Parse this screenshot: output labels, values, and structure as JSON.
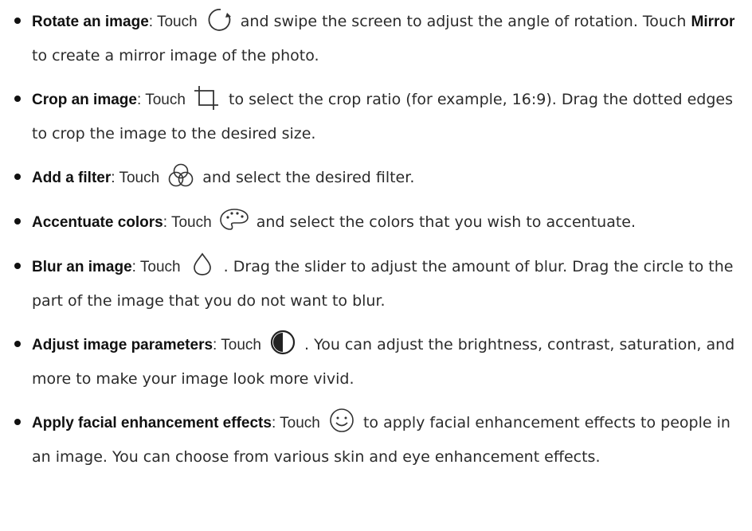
{
  "items": [
    {
      "title": "Rotate an image",
      "touch": ": Touch",
      "icon": "rotate-icon",
      "after_icon": "and swipe the screen to adjust the angle of rotation. Touch",
      "keyword2": "Mirror",
      "tail": "to create a mirror image of the photo."
    },
    {
      "title": "Crop an image",
      "touch": ": Touch",
      "icon": "crop-icon",
      "text": "to select the crop ratio (for example, 16:9). Drag the dotted edges to crop the image to the desired size."
    },
    {
      "title": "Add a filter",
      "touch": ": Touch",
      "icon": "filter-icon",
      "text": "and select the desired filter."
    },
    {
      "title": "Accentuate colors",
      "touch": ": Touch",
      "icon": "palette-icon",
      "text": "and select the colors that you wish to accentuate."
    },
    {
      "title": "Blur an image",
      "touch": ": Touch",
      "icon": "blur-drop-icon",
      "text": ". Drag the slider to adjust the amount of blur. Drag the circle to the part of the image that you do not want to blur."
    },
    {
      "title": "Adjust image parameters",
      "touch": ": Touch",
      "icon": "contrast-icon",
      "text": ". You can adjust the brightness, contrast, saturation, and more to make your image look more vivid."
    },
    {
      "title": "Apply facial enhancement effects",
      "touch": ": Touch",
      "icon": "smiley-face-icon",
      "text": "to apply facial enhancement effects to people in an image. You can choose from various skin and eye enhancement effects."
    }
  ]
}
